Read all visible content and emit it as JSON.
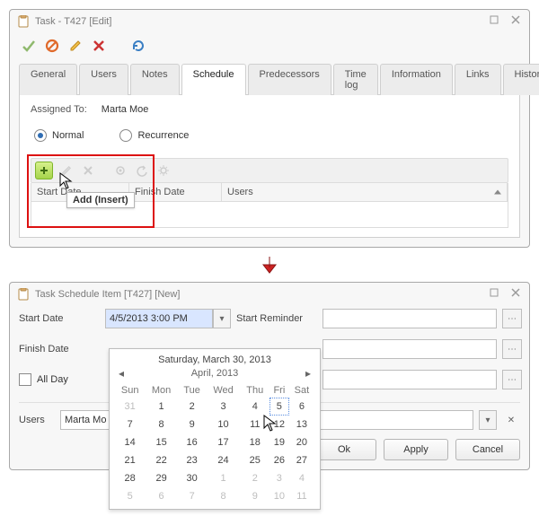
{
  "win1": {
    "title": "Task - T427 [Edit]",
    "tabs": [
      "General",
      "Users",
      "Notes",
      "Schedule",
      "Predecessors",
      "Time log",
      "Information",
      "Links",
      "History"
    ],
    "active_tab": "Schedule",
    "assigned_label": "Assigned To:",
    "assigned_value": "Marta Moe",
    "radio_normal": "Normal",
    "radio_recurrence": "Recurrence",
    "cols": {
      "start": "Start Date",
      "finish": "Finish Date",
      "users": "Users"
    },
    "tooltip": "Add (Insert)"
  },
  "win2": {
    "title": "Task Schedule Item [T427] [New]",
    "labels": {
      "start": "Start Date",
      "finish": "Finish Date",
      "allday": "All Day",
      "start_rem": "Start Reminder",
      "users": "Users"
    },
    "start_value": "4/5/2013 3:00 PM",
    "users_value": "Marta Mo",
    "buttons": {
      "ok": "Ok",
      "apply": "Apply",
      "cancel": "Cancel"
    }
  },
  "calendar": {
    "caption": "Saturday, March 30, 2013",
    "month": "April, 2013",
    "dow": [
      "Sun",
      "Mon",
      "Tue",
      "Wed",
      "Thu",
      "Fri",
      "Sat"
    ],
    "cells": [
      [
        {
          "n": 31,
          "dim": true
        },
        {
          "n": 1
        },
        {
          "n": 2
        },
        {
          "n": 3
        },
        {
          "n": 4
        },
        {
          "n": 5,
          "today": true
        },
        {
          "n": 6
        }
      ],
      [
        {
          "n": 7
        },
        {
          "n": 8
        },
        {
          "n": 9
        },
        {
          "n": 10
        },
        {
          "n": 11
        },
        {
          "n": 12
        },
        {
          "n": 13
        }
      ],
      [
        {
          "n": 14
        },
        {
          "n": 15
        },
        {
          "n": 16
        },
        {
          "n": 17
        },
        {
          "n": 18
        },
        {
          "n": 19
        },
        {
          "n": 20
        }
      ],
      [
        {
          "n": 21
        },
        {
          "n": 22
        },
        {
          "n": 23
        },
        {
          "n": 24
        },
        {
          "n": 25
        },
        {
          "n": 26
        },
        {
          "n": 27
        }
      ],
      [
        {
          "n": 28
        },
        {
          "n": 29
        },
        {
          "n": 30
        },
        {
          "n": 1,
          "dim": true
        },
        {
          "n": 2,
          "dim": true
        },
        {
          "n": 3,
          "dim": true
        },
        {
          "n": 4,
          "dim": true
        }
      ],
      [
        {
          "n": 5,
          "dim": true
        },
        {
          "n": 6,
          "dim": true
        },
        {
          "n": 7,
          "dim": true
        },
        {
          "n": 8,
          "dim": true
        },
        {
          "n": 9,
          "dim": true
        },
        {
          "n": 10,
          "dim": true
        },
        {
          "n": 11,
          "dim": true
        }
      ]
    ]
  }
}
